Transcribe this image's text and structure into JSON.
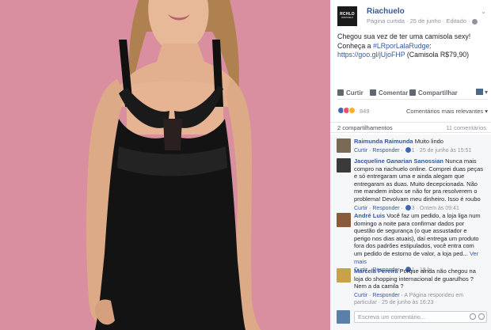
{
  "post": {
    "page_name": "Riachuelo",
    "logo_text": "RCHLO",
    "logo_subtext": "RIACHUELO",
    "meta": "Página curtida · 25 de junho · Editado ·",
    "text_line1": "Chegou sua vez de ter uma camisola sexy!",
    "text_line2_prefix": "Conheça a ",
    "hashtag": "#LRporLalaRudge",
    "text_line2_suffix": ":",
    "link": "https://goo.gl/jUjoFHP",
    "link_suffix": " (Camisola R$79,90)"
  },
  "actions": {
    "like": "Curtir",
    "comment": "Comentar",
    "share": "Compartilhar"
  },
  "reactions": {
    "count": "849",
    "sort_label": "Comentários mais relevantes ▾",
    "colors": [
      "#4267b2",
      "#f25268",
      "#f7b125"
    ]
  },
  "counts": {
    "shares": "2 compartilhamentos",
    "comments": "11 comentários"
  },
  "comments": [
    {
      "author": "Raimunda Raimunda",
      "text": "Muito lindo",
      "reply": "Curtir · Responder · ",
      "likes": "1",
      "time": " · 25 de junho às 15:51",
      "avatar_color": "#7a6a55"
    },
    {
      "author": "Jacqueline Ganarian Sanossian",
      "text": "Nunca mais compro na riachuelo online. Comprei duas peças e só entregaram uma e ainda alegam que entregaram as duas. Muito decepcionada. Não me mandem inbox se não for pra resolverem o problema! Devolvam meu dinheiro. Isso é roubo",
      "reply": "Curtir · Responder · ",
      "likes": "3",
      "time": " · Ontem às 09:41",
      "avatar_color": "#3a3a3a"
    },
    {
      "author": "André Luis",
      "text": "Você faz um pedido, a loja liga num domingo a noite para confirmar dados por questão de segurança (o que assustador e perigo nos dias atuais), daí entrega um produto fora dos padrões estipulados, você entra com um pedido de estorno de valor, a loja ped...",
      "more": "Ver mais",
      "reply": "Curtir · Responder · ",
      "likes": "1",
      "time": " · 18 h",
      "avatar_color": "#8a5a3a"
    },
    {
      "author": "Marcela Pereira",
      "text": "Porque ainda não chegou na loja do shopping internacional de guarulhos ? Nem a da camila ?",
      "reply": "Curtir · Responder · ",
      "time": "A Página respondeu em particular · 25 de junho às 16:23",
      "avatar_color": "#c8a24a"
    }
  ],
  "compose": {
    "placeholder": "Escreva um comentário...",
    "avatar_color": "#5a7fa8"
  }
}
